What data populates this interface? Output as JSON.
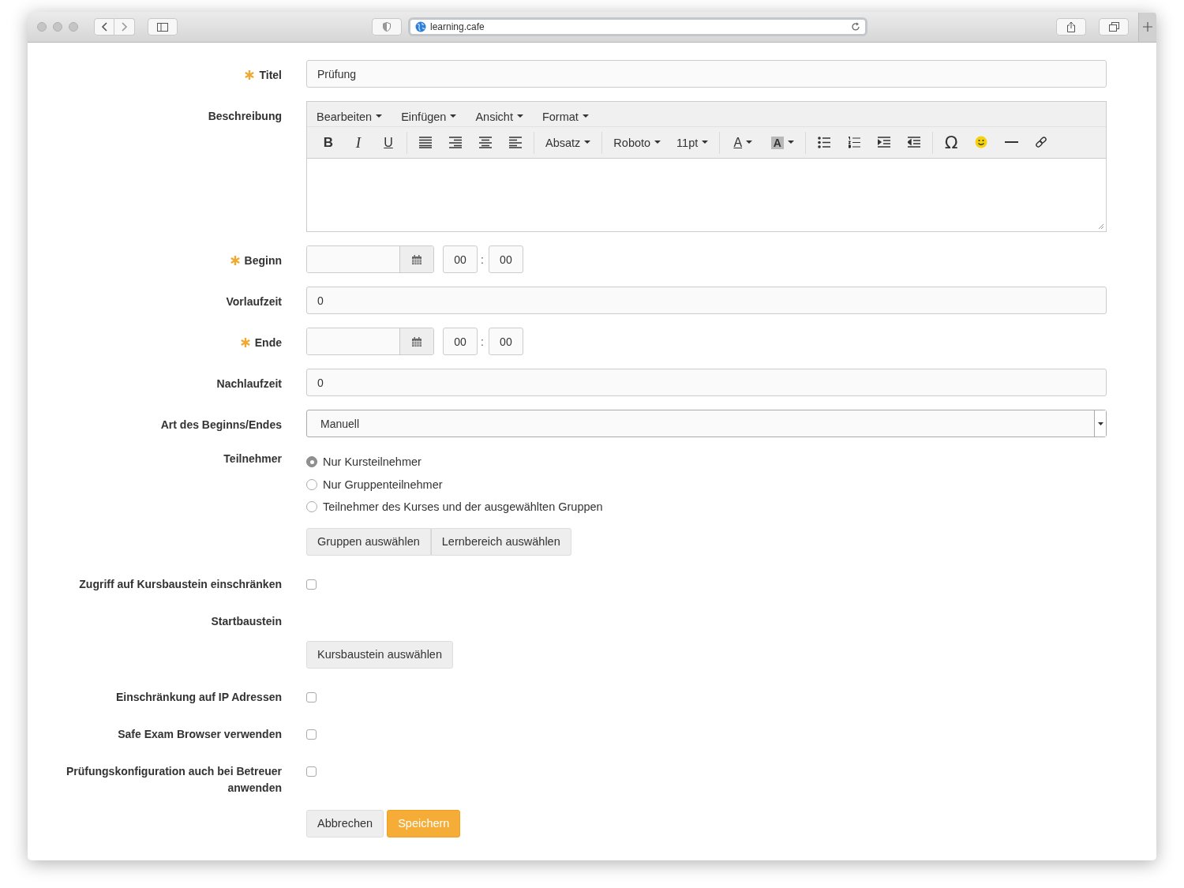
{
  "browser": {
    "url": "learning.cafe"
  },
  "form": {
    "rows": [
      {
        "kind": "text",
        "label": "Titel",
        "required": true,
        "value": "Prüfung"
      },
      {
        "kind": "editor",
        "label": "Beschreibung",
        "required": false,
        "menus": [
          "Bearbeiten",
          "Einfügen",
          "Ansicht",
          "Format"
        ],
        "toolbar": [
          [
            {
              "kind": "bold",
              "text": "B"
            },
            {
              "kind": "italic",
              "text": "I"
            },
            {
              "kind": "underline",
              "text": "U"
            }
          ],
          [
            {
              "kind": "alignfull"
            },
            {
              "kind": "alignright"
            },
            {
              "kind": "aligncenter"
            },
            {
              "kind": "alignleft"
            }
          ],
          [
            {
              "kind": "dropdown",
              "text": "Absatz"
            }
          ],
          [
            {
              "kind": "dropdown",
              "text": "Roboto"
            },
            {
              "kind": "dropdown",
              "text": "11pt"
            }
          ],
          [
            {
              "kind": "forecolor",
              "text": "A"
            },
            {
              "kind": "backcolor",
              "text": "A"
            }
          ],
          [
            {
              "kind": "bullist"
            },
            {
              "kind": "numlist"
            },
            {
              "kind": "indent"
            },
            {
              "kind": "outdent"
            }
          ],
          [
            {
              "kind": "charmap",
              "text": "Ω"
            },
            {
              "kind": "emoticon"
            },
            {
              "kind": "hr"
            },
            {
              "kind": "link"
            }
          ]
        ]
      },
      {
        "kind": "datetime",
        "label": "Beginn",
        "required": true,
        "hour": "00",
        "separator": ":",
        "minute": "00"
      },
      {
        "kind": "text",
        "label": "Vorlaufzeit",
        "required": false,
        "value": "0"
      },
      {
        "kind": "datetime",
        "label": "Ende",
        "required": true,
        "hour": "00",
        "separator": ":",
        "minute": "00"
      },
      {
        "kind": "text",
        "label": "Nachlaufzeit",
        "required": false,
        "value": "0"
      },
      {
        "kind": "select",
        "label": "Art des Beginns/Endes",
        "required": false,
        "value": "Manuell"
      },
      {
        "kind": "radio",
        "label": "Teilnehmer",
        "required": false,
        "options": [
          {
            "label": "Nur Kursteilnehmer",
            "selected": true
          },
          {
            "label": "Nur Gruppenteilnehmer",
            "selected": false
          },
          {
            "label": "Teilnehmer des Kurses und der ausgewählten Gruppen",
            "selected": false
          }
        ],
        "buttons": [
          "Gruppen auswählen",
          "Lernbereich auswählen"
        ]
      },
      {
        "kind": "checkbox",
        "label": "Zugriff auf Kursbaustein einschränken",
        "required": false,
        "checked": false
      },
      {
        "kind": "chooser",
        "label": "Startbaustein",
        "required": false,
        "button": "Kursbaustein auswählen"
      },
      {
        "kind": "checkbox",
        "label": "Einschränkung auf IP Adressen",
        "required": false,
        "checked": false
      },
      {
        "kind": "checkbox",
        "label": "Safe Exam Browser verwenden",
        "required": false,
        "checked": false
      },
      {
        "kind": "checkbox",
        "label": "Prüfungskonfiguration auch bei Betreuer anwenden",
        "required": false,
        "checked": false
      },
      {
        "kind": "actions",
        "buttons": [
          {
            "label": "Abbrechen",
            "primary": false
          },
          {
            "label": "Speichern",
            "primary": true
          }
        ]
      }
    ]
  }
}
